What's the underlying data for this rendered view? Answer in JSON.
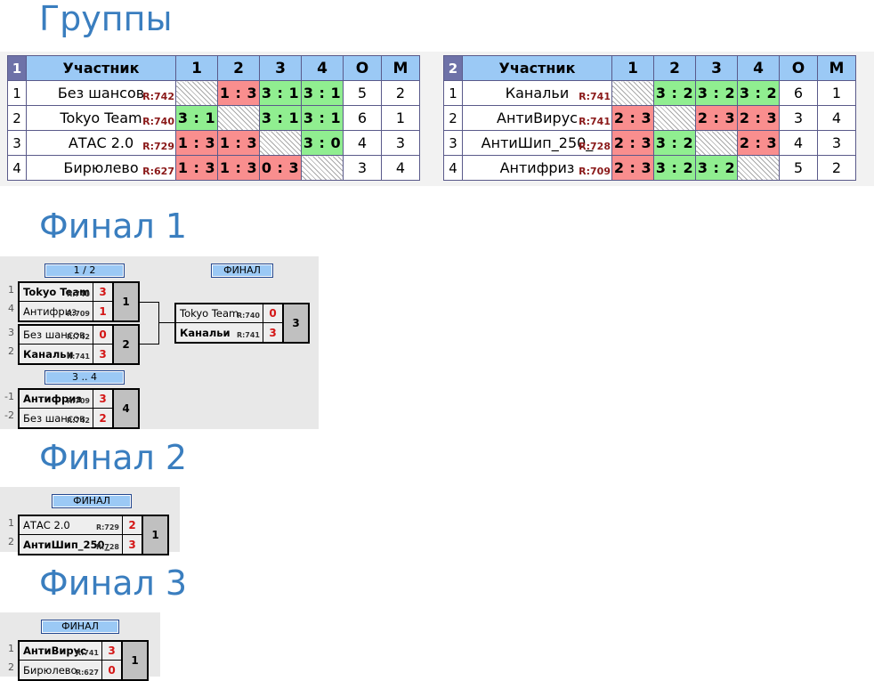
{
  "sections": {
    "groups_title": "Группы",
    "final1_title": "Финал 1",
    "final2_title": "Финал 2",
    "final3_title": "Финал 3"
  },
  "colors": {
    "title": "#3A7EBF",
    "header_blue": "#9BC9F5",
    "header_purple": "#6E72A8",
    "win_green": "#90EE90",
    "loss_red": "#F98E8E",
    "rating_red": "#8B1A1A",
    "score_red": "#D41616",
    "bracket_bg": "#e8e8e8",
    "place_grey": "#c0c0c0"
  },
  "groups": [
    {
      "number": "1",
      "headers": {
        "participant": "Участник",
        "cols": [
          "1",
          "2",
          "3",
          "4"
        ],
        "points": "О",
        "place": "М"
      },
      "rows": [
        {
          "rank": "1",
          "name": "Без шансов",
          "rating": "R:742",
          "cells": [
            {
              "text": "",
              "state": "self"
            },
            {
              "text": "1 : 3",
              "state": "loss"
            },
            {
              "text": "3 : 1",
              "state": "win"
            },
            {
              "text": "3 : 1",
              "state": "win"
            }
          ],
          "points": "5",
          "place": "2"
        },
        {
          "rank": "2",
          "name": "Tokyo Team",
          "rating": "R:740",
          "cells": [
            {
              "text": "3 : 1",
              "state": "win"
            },
            {
              "text": "",
              "state": "self"
            },
            {
              "text": "3 : 1",
              "state": "win"
            },
            {
              "text": "3 : 1",
              "state": "win"
            }
          ],
          "points": "6",
          "place": "1"
        },
        {
          "rank": "3",
          "name": "АТАС 2.0",
          "rating": "R:729",
          "cells": [
            {
              "text": "1 : 3",
              "state": "loss"
            },
            {
              "text": "1 : 3",
              "state": "loss"
            },
            {
              "text": "",
              "state": "self"
            },
            {
              "text": "3 : 0",
              "state": "win"
            }
          ],
          "points": "4",
          "place": "3"
        },
        {
          "rank": "4",
          "name": "Бирюлево",
          "rating": "R:627",
          "cells": [
            {
              "text": "1 : 3",
              "state": "loss"
            },
            {
              "text": "1 : 3",
              "state": "loss"
            },
            {
              "text": "0 : 3",
              "state": "loss"
            },
            {
              "text": "",
              "state": "self"
            }
          ],
          "points": "3",
          "place": "4"
        }
      ]
    },
    {
      "number": "2",
      "headers": {
        "participant": "Участник",
        "cols": [
          "1",
          "2",
          "3",
          "4"
        ],
        "points": "О",
        "place": "М"
      },
      "rows": [
        {
          "rank": "1",
          "name": "Канальи",
          "rating": "R:741",
          "cells": [
            {
              "text": "",
              "state": "self"
            },
            {
              "text": "3 : 2",
              "state": "win"
            },
            {
              "text": "3 : 2",
              "state": "win"
            },
            {
              "text": "3 : 2",
              "state": "win"
            }
          ],
          "points": "6",
          "place": "1"
        },
        {
          "rank": "2",
          "name": "АнтиВирус",
          "rating": "R:741",
          "cells": [
            {
              "text": "2 : 3",
              "state": "loss"
            },
            {
              "text": "",
              "state": "self"
            },
            {
              "text": "2 : 3",
              "state": "loss"
            },
            {
              "text": "2 : 3",
              "state": "loss"
            }
          ],
          "points": "3",
          "place": "4"
        },
        {
          "rank": "3",
          "name": "АнтиШип_250_",
          "rating": "R:728",
          "cells": [
            {
              "text": "2 : 3",
              "state": "loss"
            },
            {
              "text": "3 : 2",
              "state": "win"
            },
            {
              "text": "",
              "state": "self"
            },
            {
              "text": "2 : 3",
              "state": "loss"
            }
          ],
          "points": "4",
          "place": "3"
        },
        {
          "rank": "4",
          "name": "Антифриз",
          "rating": "R:709",
          "cells": [
            {
              "text": "2 : 3",
              "state": "loss"
            },
            {
              "text": "3 : 2",
              "state": "win"
            },
            {
              "text": "3 : 2",
              "state": "win"
            },
            {
              "text": "",
              "state": "self"
            }
          ],
          "points": "5",
          "place": "2"
        }
      ]
    }
  ],
  "final1": {
    "labels": {
      "semifinal": "1 / 2",
      "final": "ФИНАЛ",
      "third": "3 .. 4"
    },
    "semifinals": [
      {
        "place": "1",
        "top": {
          "seed": "1",
          "name": "Tokyo Team",
          "rating": "R:740",
          "score": "3",
          "winner": true
        },
        "bottom": {
          "seed": "4",
          "name": "Антифриз",
          "rating": "R:709",
          "score": "1",
          "winner": false
        }
      },
      {
        "place": "2",
        "top": {
          "seed": "3",
          "name": "Без шансов",
          "rating": "R:742",
          "score": "0",
          "winner": false
        },
        "bottom": {
          "seed": "2",
          "name": "Канальи",
          "rating": "R:741",
          "score": "3",
          "winner": true
        }
      }
    ],
    "final": {
      "place": "3",
      "top": {
        "seed": "",
        "name": "Tokyo Team",
        "rating": "R:740",
        "score": "0",
        "winner": false
      },
      "bottom": {
        "seed": "",
        "name": "Канальи",
        "rating": "R:741",
        "score": "3",
        "winner": true
      }
    },
    "third_place": {
      "place": "4",
      "top": {
        "seed": "-1",
        "name": "Антифриз",
        "rating": "R:709",
        "score": "3",
        "winner": true
      },
      "bottom": {
        "seed": "-2",
        "name": "Без шансов",
        "rating": "R:742",
        "score": "2",
        "winner": false
      }
    }
  },
  "final2": {
    "label": "ФИНАЛ",
    "match": {
      "place": "1",
      "top": {
        "seed": "1",
        "name": "АТАС 2.0",
        "rating": "R:729",
        "score": "2",
        "winner": false
      },
      "bottom": {
        "seed": "2",
        "name": "АнтиШип_250_",
        "rating": "R:728",
        "score": "3",
        "winner": true
      }
    }
  },
  "final3": {
    "label": "ФИНАЛ",
    "match": {
      "place": "1",
      "top": {
        "seed": "1",
        "name": "АнтиВирус",
        "rating": "R:741",
        "score": "3",
        "winner": true
      },
      "bottom": {
        "seed": "2",
        "name": "Бирюлево",
        "rating": "R:627",
        "score": "0",
        "winner": false
      }
    }
  }
}
